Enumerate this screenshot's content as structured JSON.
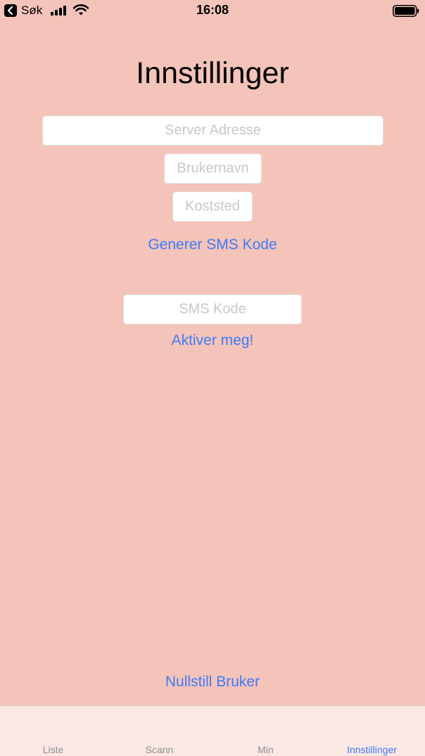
{
  "status_bar": {
    "back_label": "Søk",
    "time": "16:08"
  },
  "page": {
    "title": "Innstillinger"
  },
  "form": {
    "server_placeholder": "Server Adresse",
    "username_placeholder": "Brukernavn",
    "cost_center_placeholder": "Koststed",
    "generate_sms_label": "Generer SMS Kode",
    "sms_code_placeholder": "SMS Kode",
    "activate_label": "Aktiver meg!",
    "reset_user_label": "Nullstill Bruker"
  },
  "tabs": [
    {
      "label": "Liste",
      "active": false
    },
    {
      "label": "Scann",
      "active": false
    },
    {
      "label": "Min",
      "active": false
    },
    {
      "label": "Innstillinger",
      "active": true
    }
  ],
  "colors": {
    "background": "#f4c3b9",
    "accent": "#3f7bf6",
    "tab_bar": "#f9e8e4"
  }
}
